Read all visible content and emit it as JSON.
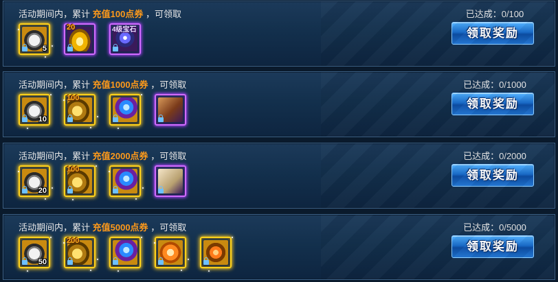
{
  "rows": [
    {
      "desc_prefix": "活动期间内，累计",
      "desc_highlight": "充值100点券",
      "desc_suffix": "，可领取",
      "progress": "已达成：0/100",
      "button": "领取奖励",
      "items": [
        {
          "icon": "wing-icon",
          "frame": "gold",
          "qty": "5",
          "badge": ""
        },
        {
          "icon": "gold-ingot-icon",
          "frame": "purple",
          "qty": "",
          "badge": "20"
        },
        {
          "icon": "gem-box-icon",
          "frame": "purple",
          "qty": "",
          "badge": "4级宝石"
        }
      ]
    },
    {
      "desc_prefix": "活动期间内，累计",
      "desc_highlight": "充值1000点券",
      "desc_suffix": "，可领取",
      "progress": "已达成：0/1000",
      "button": "领取奖励",
      "items": [
        {
          "icon": "wing-icon",
          "frame": "gold",
          "qty": "10",
          "badge": ""
        },
        {
          "icon": "gold-nugget-icon",
          "frame": "gold",
          "qty": "",
          "badge": "100"
        },
        {
          "icon": "crystal-icon",
          "frame": "gold",
          "qty": "",
          "badge": ""
        },
        {
          "icon": "book-icon",
          "frame": "purple",
          "qty": "",
          "badge": ""
        }
      ]
    },
    {
      "desc_prefix": "活动期间内，累计",
      "desc_highlight": "充值2000点券",
      "desc_suffix": "，可领取",
      "progress": "已达成：0/2000",
      "button": "领取奖励",
      "items": [
        {
          "icon": "wing-icon",
          "frame": "gold",
          "qty": "20",
          "badge": ""
        },
        {
          "icon": "gold-nugget-icon",
          "frame": "gold",
          "qty": "",
          "badge": "100"
        },
        {
          "icon": "crystal-icon",
          "frame": "gold",
          "qty": "",
          "badge": ""
        },
        {
          "icon": "scroll-icon",
          "frame": "purple",
          "qty": "",
          "badge": ""
        }
      ]
    },
    {
      "desc_prefix": "活动期间内，累计",
      "desc_highlight": "充值5000点券",
      "desc_suffix": "，可领取",
      "progress": "已达成：0/5000",
      "button": "领取奖励",
      "items": [
        {
          "icon": "wing-icon",
          "frame": "gold",
          "qty": "50",
          "badge": ""
        },
        {
          "icon": "gold-nugget-icon",
          "frame": "gold",
          "qty": "",
          "badge": "200"
        },
        {
          "icon": "crystal-icon",
          "frame": "gold",
          "qty": "",
          "badge": ""
        },
        {
          "icon": "flame-icon",
          "frame": "gold",
          "qty": "",
          "badge": ""
        },
        {
          "icon": "fire-orb-icon",
          "frame": "gold",
          "qty": "",
          "badge": ""
        }
      ]
    }
  ]
}
